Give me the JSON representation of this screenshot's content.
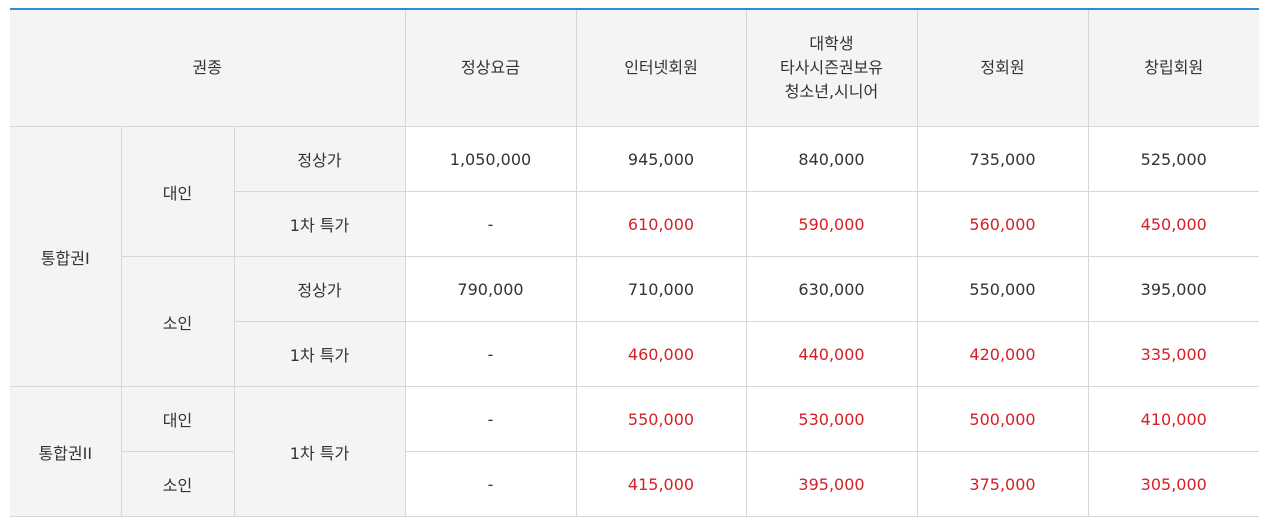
{
  "header": {
    "ticket_type": "권종",
    "regular": "정상요금",
    "internet": "인터넷회원",
    "student_lines": [
      "대학생",
      "타사시즌권보유",
      "청소년,시니어"
    ],
    "member": "정회원",
    "founding": "창립회원"
  },
  "groups": {
    "g1": "통합권I",
    "g2": "통합권II"
  },
  "age": {
    "adult": "대인",
    "child": "소인"
  },
  "price_type": {
    "normal": "정상가",
    "early": "1차 특가"
  },
  "rows": {
    "r1": [
      "1,050,000",
      "945,000",
      "840,000",
      "735,000",
      "525,000"
    ],
    "r2": [
      "-",
      "610,000",
      "590,000",
      "560,000",
      "450,000"
    ],
    "r3": [
      "790,000",
      "710,000",
      "630,000",
      "550,000",
      "395,000"
    ],
    "r4": [
      "-",
      "460,000",
      "440,000",
      "420,000",
      "335,000"
    ],
    "r5": [
      "-",
      "550,000",
      "530,000",
      "500,000",
      "410,000"
    ],
    "r6": [
      "-",
      "415,000",
      "395,000",
      "375,000",
      "305,000"
    ]
  },
  "colors": {
    "accent_border": "#2f8ccf",
    "discount_red": "#d61f26",
    "header_bg": "#f4f4f4"
  }
}
